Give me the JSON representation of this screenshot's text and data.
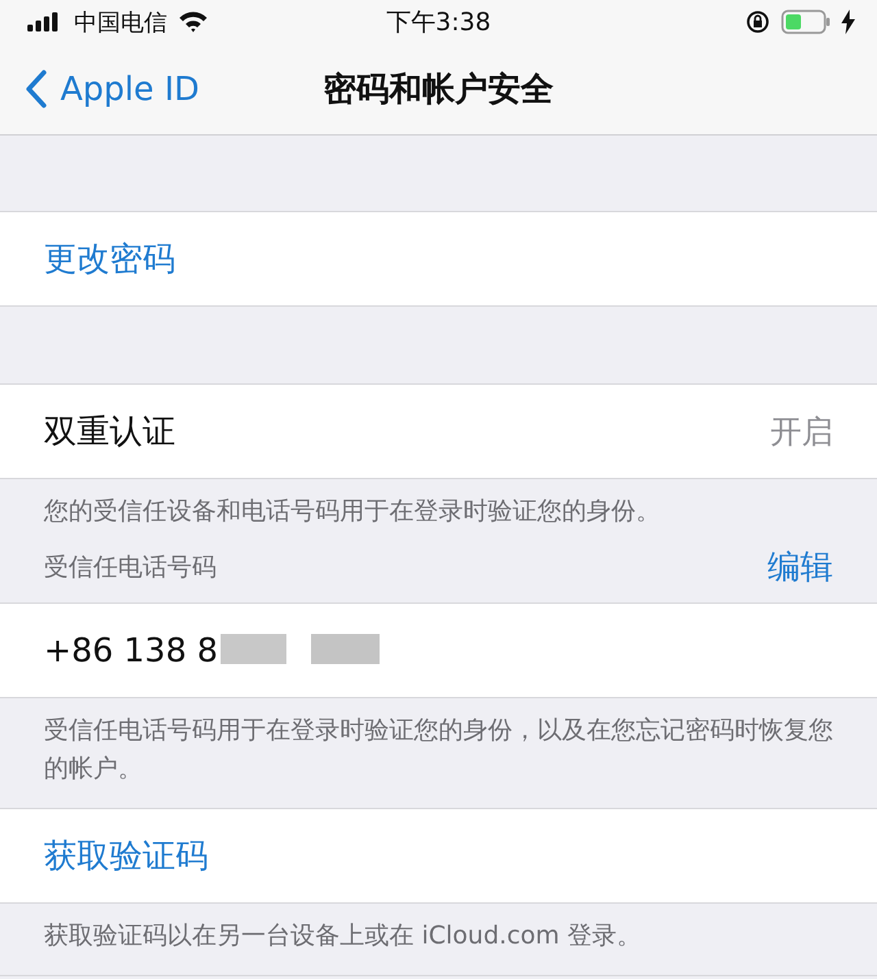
{
  "status_bar": {
    "carrier": "中国电信",
    "time": "下午3:38"
  },
  "nav": {
    "back": "Apple ID",
    "title": "密码和帐户安全"
  },
  "sections": [
    {
      "rows": [
        {
          "kind": "action",
          "label": "更改密码"
        }
      ]
    },
    {
      "rows": [
        {
          "kind": "value",
          "label": "双重认证",
          "value": "开启"
        }
      ],
      "footer": "您的受信任设备和电话号码用于在登录时验证您的身份。",
      "header": {
        "label": "受信任电话号码",
        "action": "编辑"
      }
    },
    {
      "rows": [
        {
          "kind": "phone",
          "label": "+86 138 8"
        }
      ],
      "footer": "受信任电话号码用于在登录时验证您的身份，以及在您忘记密码时恢复您的帐户。"
    },
    {
      "rows": [
        {
          "kind": "action",
          "label": "获取验证码"
        }
      ],
      "footer": "获取验证码以在另一台设备上或在 iCloud.com 登录。"
    }
  ]
}
